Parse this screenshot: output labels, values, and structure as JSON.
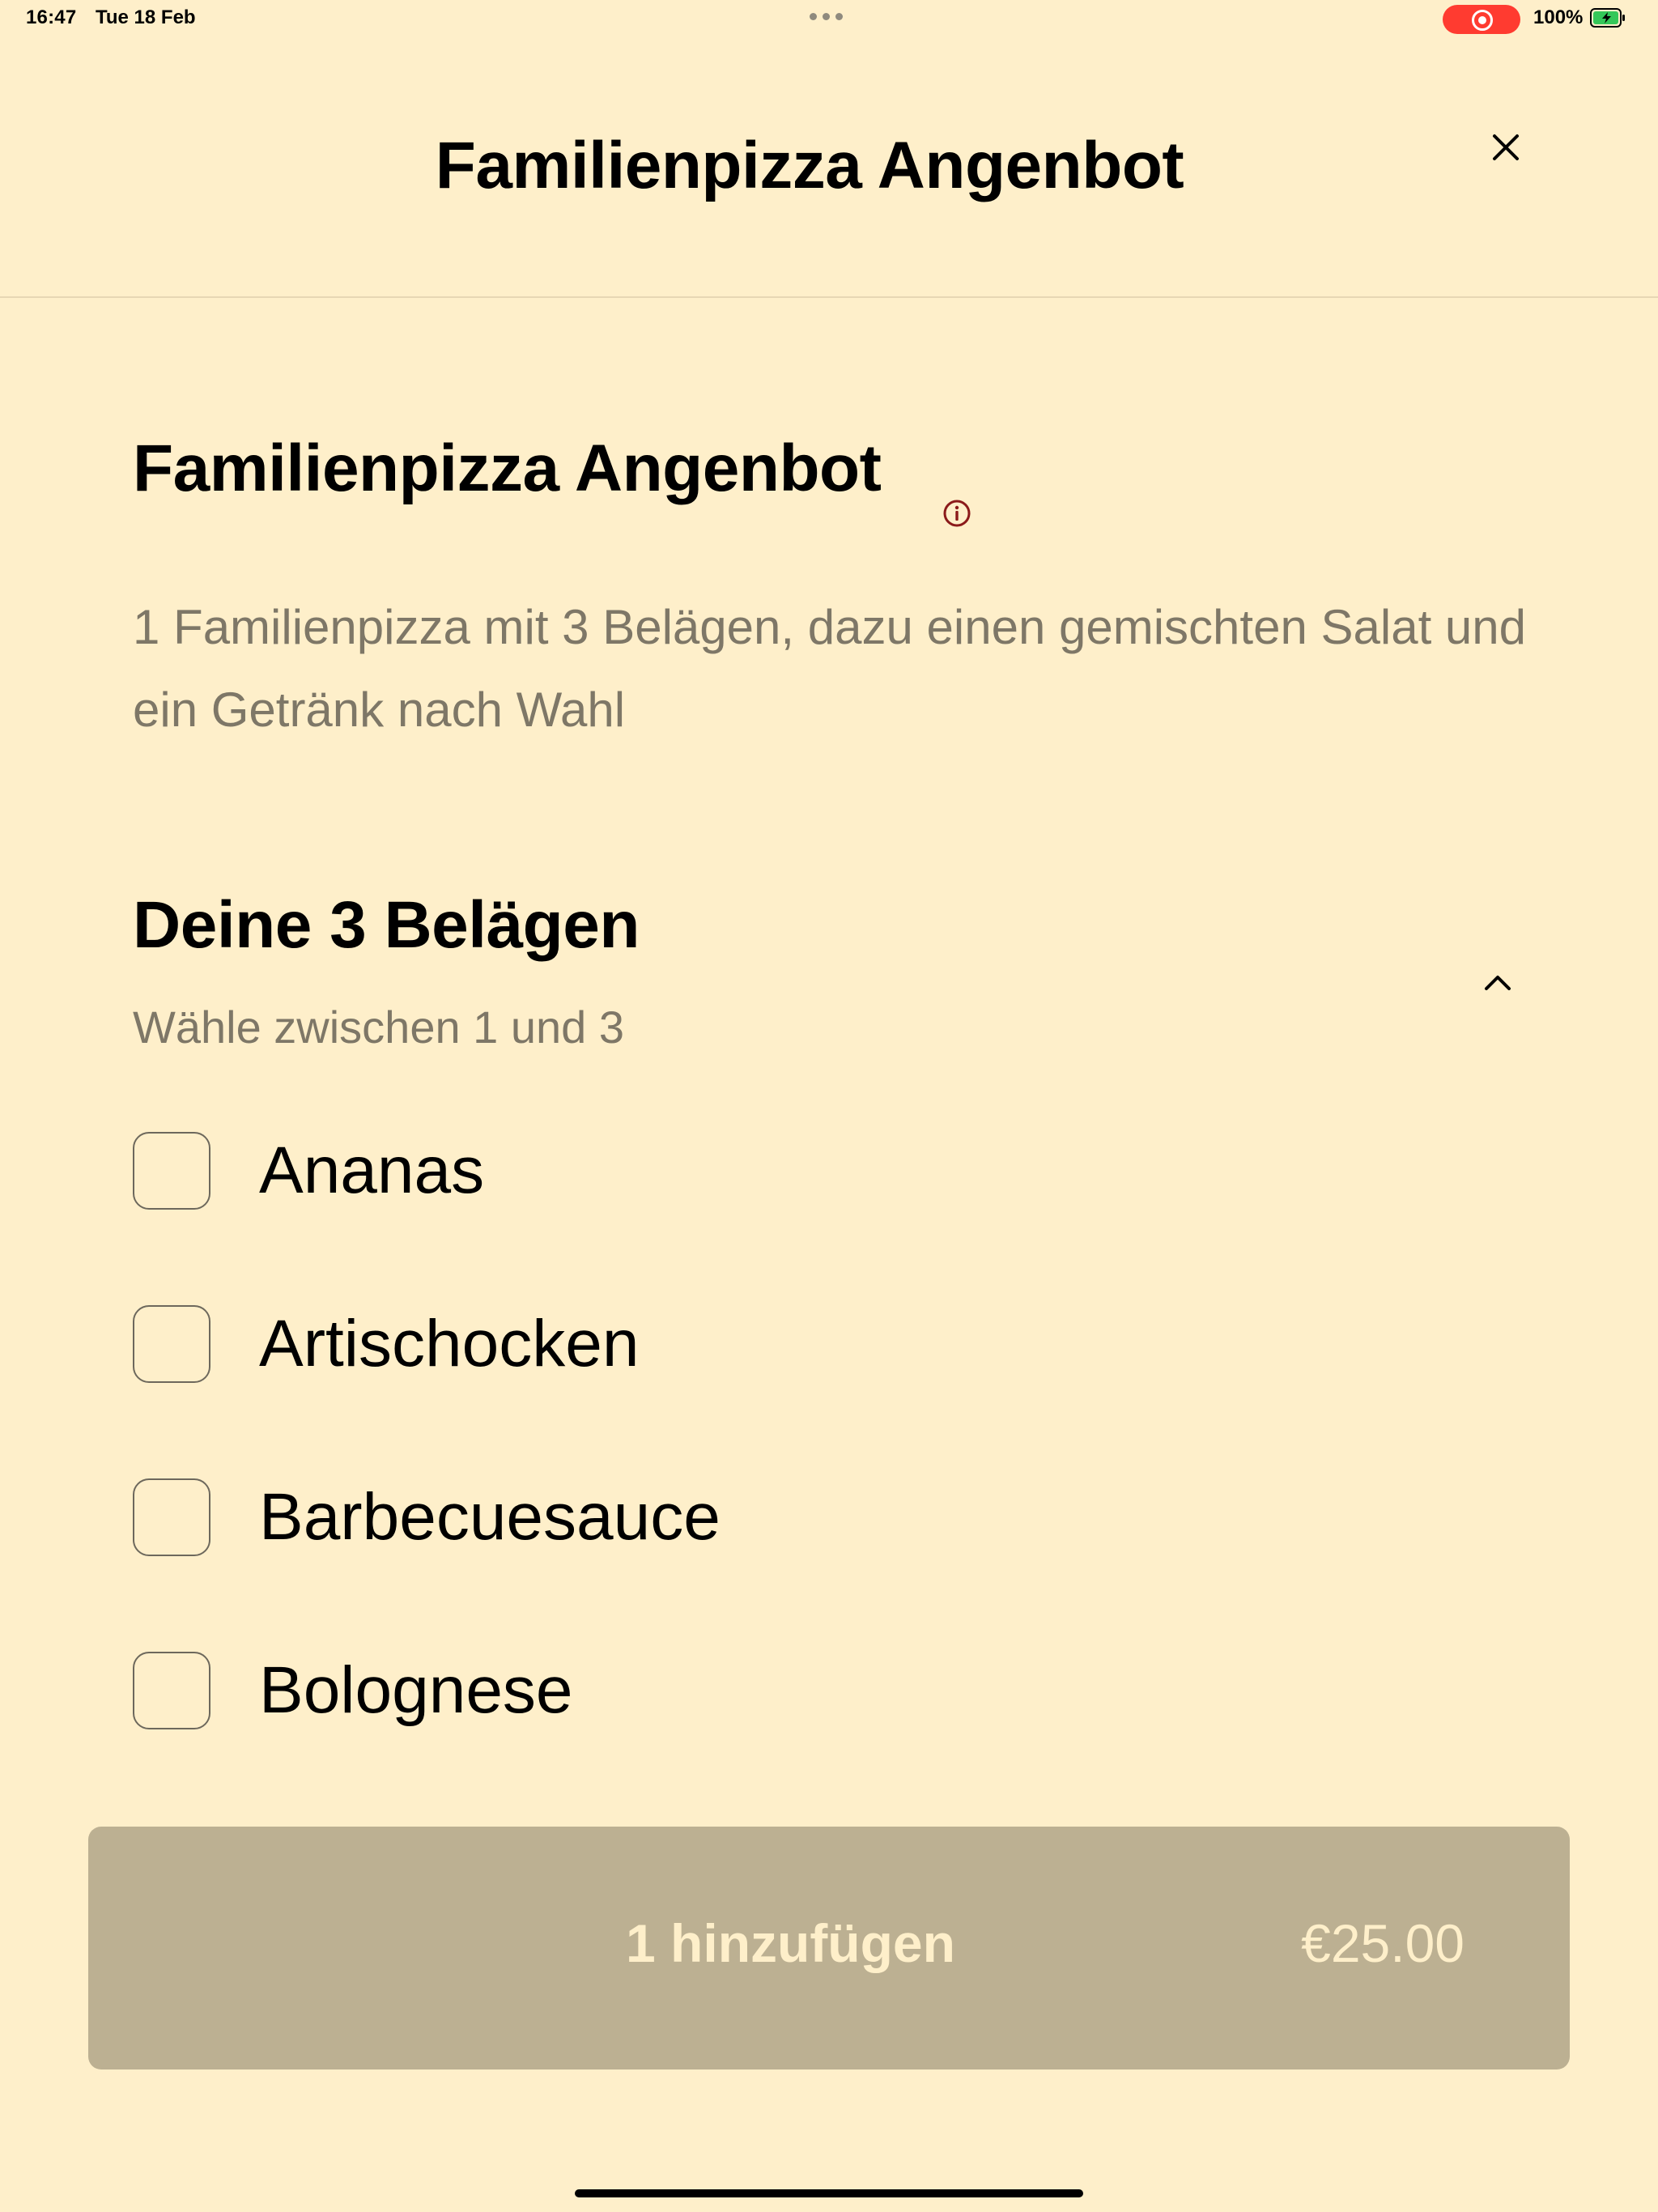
{
  "status_bar": {
    "time": "16:47",
    "date": "Tue 18 Feb",
    "battery": "100%"
  },
  "header": {
    "title": "Familienpizza Angenbot",
    "close_icon": "close-icon"
  },
  "product": {
    "title": "Familienpizza Angenbot",
    "info_icon": "info-icon",
    "description": "1 Familienpizza mit 3 Belägen, dazu einen gemischten Salat und ein Getränk nach Wahl"
  },
  "toppings": {
    "title": "Deine 3 Belägen",
    "subtitle": "Wähle zwischen 1 und 3",
    "options": [
      {
        "label": "Ananas",
        "checked": false
      },
      {
        "label": "Artischocken",
        "checked": false
      },
      {
        "label": "Barbecuesauce",
        "checked": false
      },
      {
        "label": "Bolognese",
        "checked": false
      }
    ]
  },
  "add_button": {
    "label": "1 hinzufügen",
    "price": "€25.00"
  },
  "colors": {
    "background": "#feefca",
    "button": "#bcb092",
    "record": "#ff3b30",
    "info": "#8b1a1a"
  }
}
